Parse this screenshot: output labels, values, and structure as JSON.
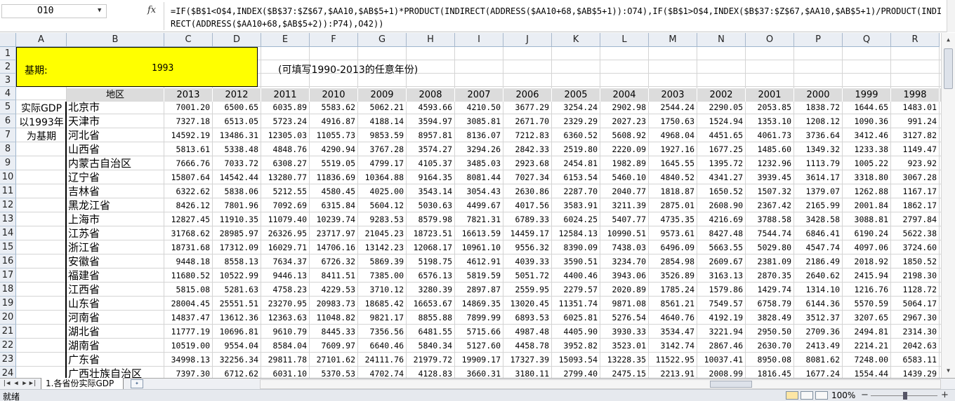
{
  "name_box": "O10",
  "fx_icon": "fx-icon",
  "formula": "=IF($B$1<O$4,INDEX($B$37:$Z$67,$AA10,$AB$5+1)*PRODUCT(INDIRECT(ADDRESS($AA10+68,$AB$5+1)):O74),IF($B$1>O$4,INDEX($B$37:$Z$67,$AA10,$AB$5+1)/PRODUCT(INDIRECT(ADDRESS($AA10+68,$AB$5+2)):P74),O42))",
  "col_headers": [
    "A",
    "B",
    "C",
    "D",
    "E",
    "F",
    "G",
    "H",
    "I",
    "J",
    "K",
    "L",
    "M",
    "N",
    "O",
    "P",
    "Q",
    "R"
  ],
  "row_numbers": [
    "1",
    "2",
    "3",
    "4",
    "5",
    "6",
    "7",
    "8",
    "9",
    "10",
    "11",
    "12",
    "13",
    "14",
    "15",
    "16",
    "17",
    "18",
    "19",
    "20",
    "21",
    "22",
    "23",
    "24"
  ],
  "base_label": "基期:",
  "base_year": "1993",
  "hint": "(可填写1990-2013的任意年份)",
  "region_header": "地区",
  "years": [
    "2013",
    "2012",
    "2011",
    "2010",
    "2009",
    "2008",
    "2007",
    "2006",
    "2005",
    "2004",
    "2003",
    "2002",
    "2001",
    "2000",
    "1999",
    "1998"
  ],
  "side_note": [
    "实际GDP",
    "以1993年",
    "为基期"
  ],
  "rows": [
    {
      "region": "北京市",
      "values": [
        "7001.20",
        "6500.65",
        "6035.89",
        "5583.62",
        "5062.21",
        "4593.66",
        "4210.50",
        "3677.29",
        "3254.24",
        "2902.98",
        "2544.24",
        "2290.05",
        "2053.85",
        "1838.72",
        "1644.65",
        "1483.01"
      ]
    },
    {
      "region": "天津市",
      "values": [
        "7327.18",
        "6513.05",
        "5723.24",
        "4916.87",
        "4188.14",
        "3594.97",
        "3085.81",
        "2671.70",
        "2329.29",
        "2027.23",
        "1750.63",
        "1524.94",
        "1353.10",
        "1208.12",
        "1090.36",
        "991.24"
      ]
    },
    {
      "region": "河北省",
      "values": [
        "14592.19",
        "13486.31",
        "12305.03",
        "11055.73",
        "9853.59",
        "8957.81",
        "8136.07",
        "7212.83",
        "6360.52",
        "5608.92",
        "4968.04",
        "4451.65",
        "4061.73",
        "3736.64",
        "3412.46",
        "3127.82"
      ]
    },
    {
      "region": "山西省",
      "values": [
        "5813.61",
        "5338.48",
        "4848.76",
        "4290.94",
        "3767.28",
        "3574.27",
        "3294.26",
        "2842.33",
        "2519.80",
        "2220.09",
        "1927.16",
        "1677.25",
        "1485.60",
        "1349.32",
        "1233.38",
        "1149.47"
      ]
    },
    {
      "region": "内蒙古自治区",
      "values": [
        "7666.76",
        "7033.72",
        "6308.27",
        "5519.05",
        "4799.17",
        "4105.37",
        "3485.03",
        "2923.68",
        "2454.81",
        "1982.89",
        "1645.55",
        "1395.72",
        "1232.96",
        "1113.79",
        "1005.22",
        "923.92"
      ]
    },
    {
      "region": "辽宁省",
      "values": [
        "15807.64",
        "14542.44",
        "13280.77",
        "11836.69",
        "10364.88",
        "9164.35",
        "8081.44",
        "7027.34",
        "6153.54",
        "5460.10",
        "4840.52",
        "4341.27",
        "3939.45",
        "3614.17",
        "3318.80",
        "3067.28"
      ]
    },
    {
      "region": "吉林省",
      "values": [
        "6322.62",
        "5838.06",
        "5212.55",
        "4580.45",
        "4025.00",
        "3543.14",
        "3054.43",
        "2630.86",
        "2287.70",
        "2040.77",
        "1818.87",
        "1650.52",
        "1507.32",
        "1379.07",
        "1262.88",
        "1167.17"
      ]
    },
    {
      "region": "黑龙江省",
      "values": [
        "8426.12",
        "7801.96",
        "7092.69",
        "6315.84",
        "5604.12",
        "5030.63",
        "4499.67",
        "4017.56",
        "3583.91",
        "3211.39",
        "2875.01",
        "2608.90",
        "2367.42",
        "2165.99",
        "2001.84",
        "1862.17"
      ]
    },
    {
      "region": "上海市",
      "values": [
        "12827.45",
        "11910.35",
        "11079.40",
        "10239.74",
        "9283.53",
        "8579.98",
        "7821.31",
        "6789.33",
        "6024.25",
        "5407.77",
        "4735.35",
        "4216.69",
        "3788.58",
        "3428.58",
        "3088.81",
        "2797.84"
      ]
    },
    {
      "region": "江苏省",
      "values": [
        "31768.62",
        "28985.97",
        "26326.95",
        "23717.97",
        "21045.23",
        "18723.51",
        "16613.59",
        "14459.17",
        "12584.13",
        "10990.51",
        "9573.61",
        "8427.48",
        "7544.74",
        "6846.41",
        "6190.24",
        "5622.38"
      ]
    },
    {
      "region": "浙江省",
      "values": [
        "18731.68",
        "17312.09",
        "16029.71",
        "14706.16",
        "13142.23",
        "12068.17",
        "10961.10",
        "9556.32",
        "8390.09",
        "7438.03",
        "6496.09",
        "5663.55",
        "5029.80",
        "4547.74",
        "4097.06",
        "3724.60"
      ]
    },
    {
      "region": "安徽省",
      "values": [
        "9448.18",
        "8558.13",
        "7634.37",
        "6726.32",
        "5869.39",
        "5198.75",
        "4612.91",
        "4039.33",
        "3590.51",
        "3234.70",
        "2854.98",
        "2609.67",
        "2381.09",
        "2186.49",
        "2018.92",
        "1850.52"
      ]
    },
    {
      "region": "福建省",
      "values": [
        "11680.52",
        "10522.99",
        "9446.13",
        "8411.51",
        "7385.00",
        "6576.13",
        "5819.59",
        "5051.72",
        "4400.46",
        "3943.06",
        "3526.89",
        "3163.13",
        "2870.35",
        "2640.62",
        "2415.94",
        "2198.30"
      ]
    },
    {
      "region": "江西省",
      "values": [
        "5815.08",
        "5281.63",
        "4758.23",
        "4229.53",
        "3710.12",
        "3280.39",
        "2897.87",
        "2559.95",
        "2279.57",
        "2020.89",
        "1785.24",
        "1579.86",
        "1429.74",
        "1314.10",
        "1216.76",
        "1128.72"
      ]
    },
    {
      "region": "山东省",
      "values": [
        "28004.45",
        "25551.51",
        "23270.95",
        "20983.73",
        "18685.42",
        "16653.67",
        "14869.35",
        "13020.45",
        "11351.74",
        "9871.08",
        "8561.21",
        "7549.57",
        "6758.79",
        "6144.36",
        "5570.59",
        "5064.17"
      ]
    },
    {
      "region": "河南省",
      "values": [
        "14837.47",
        "13612.36",
        "12363.63",
        "11048.82",
        "9821.17",
        "8855.88",
        "7899.99",
        "6893.53",
        "6025.81",
        "5276.54",
        "4640.76",
        "4192.19",
        "3828.49",
        "3512.37",
        "3207.65",
        "2967.30"
      ]
    },
    {
      "region": "湖北省",
      "values": [
        "11777.19",
        "10696.81",
        "9610.79",
        "8445.33",
        "7356.56",
        "6481.55",
        "5715.66",
        "4987.48",
        "4405.90",
        "3930.33",
        "3534.47",
        "3221.94",
        "2950.50",
        "2709.36",
        "2494.81",
        "2314.30"
      ]
    },
    {
      "region": "湖南省",
      "values": [
        "10519.00",
        "9554.04",
        "8584.04",
        "7609.97",
        "6640.46",
        "5840.34",
        "5127.60",
        "4458.78",
        "3952.82",
        "3523.01",
        "3142.74",
        "2867.46",
        "2630.70",
        "2413.49",
        "2214.21",
        "2042.63"
      ]
    },
    {
      "region": "广东省",
      "values": [
        "34998.13",
        "32256.34",
        "29811.78",
        "27101.62",
        "24111.76",
        "21979.72",
        "19909.17",
        "17327.39",
        "15093.54",
        "13228.35",
        "11522.95",
        "10037.41",
        "8950.08",
        "8081.62",
        "7248.00",
        "6583.11"
      ]
    },
    {
      "region": "广西壮族自治区",
      "values": [
        "7397.30",
        "6712.62",
        "6031.10",
        "5370.53",
        "4702.74",
        "4128.83",
        "3660.31",
        "3180.11",
        "2799.40",
        "2475.15",
        "2213.91",
        "2008.99",
        "1816.45",
        "1677.24",
        "1554.44",
        "1439.29"
      ]
    }
  ],
  "sheet_tab": "1.各省份实际GDP",
  "status": "就绪",
  "zoom": "100%"
}
